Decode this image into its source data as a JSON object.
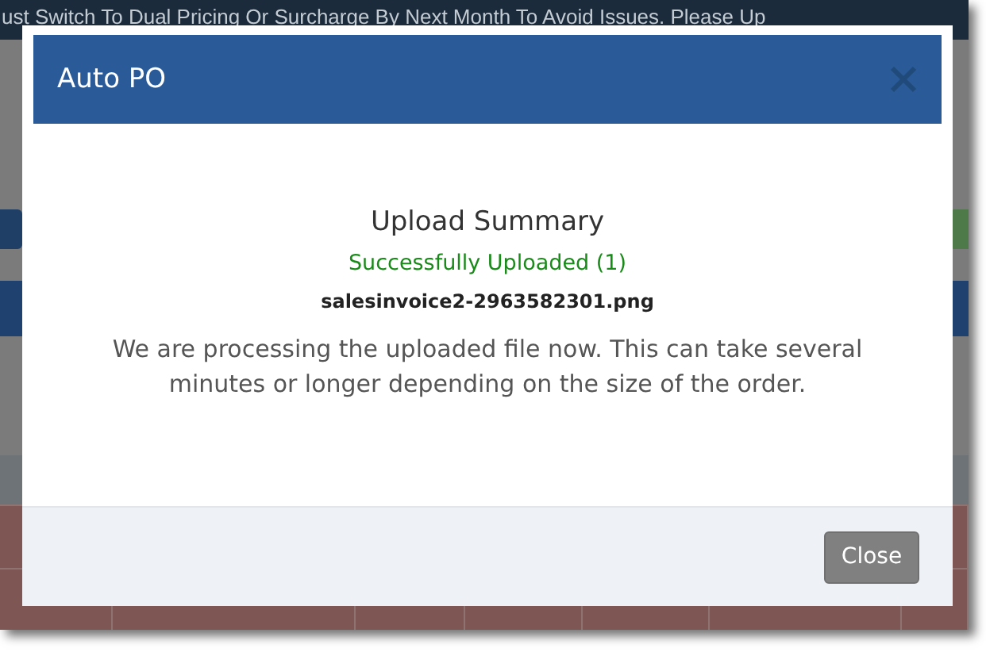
{
  "background": {
    "banner": "ust Switch To Dual Pricing Or Surcharge By Next Month To Avoid Issues. Please Up"
  },
  "modal": {
    "title": "Auto PO",
    "heading": "Upload Summary",
    "status": "Successfully Uploaded (1)",
    "file": "salesinvoice2-2963582301.png",
    "message": "We are processing the uploaded file now. This can take several minutes or longer depending on the size of the order.",
    "button": "Close"
  }
}
